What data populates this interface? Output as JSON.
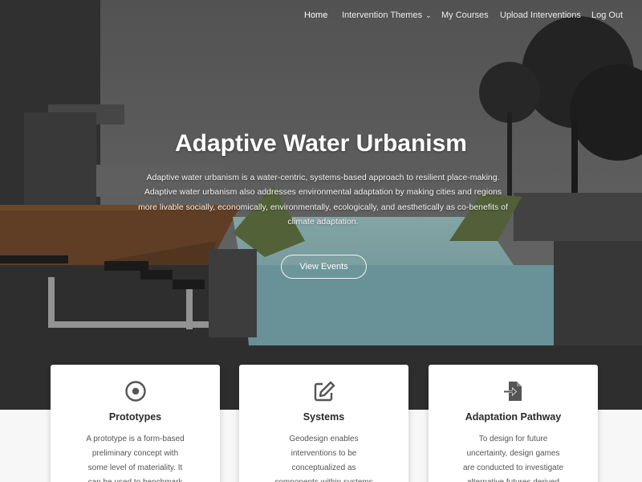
{
  "nav": {
    "items": [
      {
        "label": "Home",
        "active": true
      },
      {
        "label": "Intervention Themes",
        "dropdown": true
      },
      {
        "label": "My Courses"
      },
      {
        "label": "Upload Interventions"
      },
      {
        "label": "Log Out"
      }
    ],
    "dropdown_icon": "chevron-down-icon"
  },
  "hero": {
    "title": "Adaptive Water Urbanism",
    "description": "Adaptive water urbanism is a water-centric, systems-based approach to resilient place-making. Adaptive water urbanism also addresses environmental adaptation by making cities and regions more livable socially, economically, environmentally, ecologically, and aesthetically as co-benefits of climate adaptation.",
    "button_label": "View Events"
  },
  "cards": [
    {
      "icon": "target-circle-icon",
      "title": "Prototypes",
      "text": "A prototype is a form-based preliminary concept with some level of materiality. It can be used to benchmark"
    },
    {
      "icon": "edit-pencil-icon",
      "title": "Systems",
      "text": "Geodesign enables interventions to be conceptualized as components within systems of"
    },
    {
      "icon": "file-import-icon",
      "title": "Adaptation Pathway",
      "text": "To design for future uncertainty, design games are conducted to investigate alternative futures derived"
    }
  ],
  "colors": {
    "icon": "#555555",
    "title_text": "#ffffff",
    "card_bg": "#ffffff",
    "water": "#8fc4c8"
  }
}
